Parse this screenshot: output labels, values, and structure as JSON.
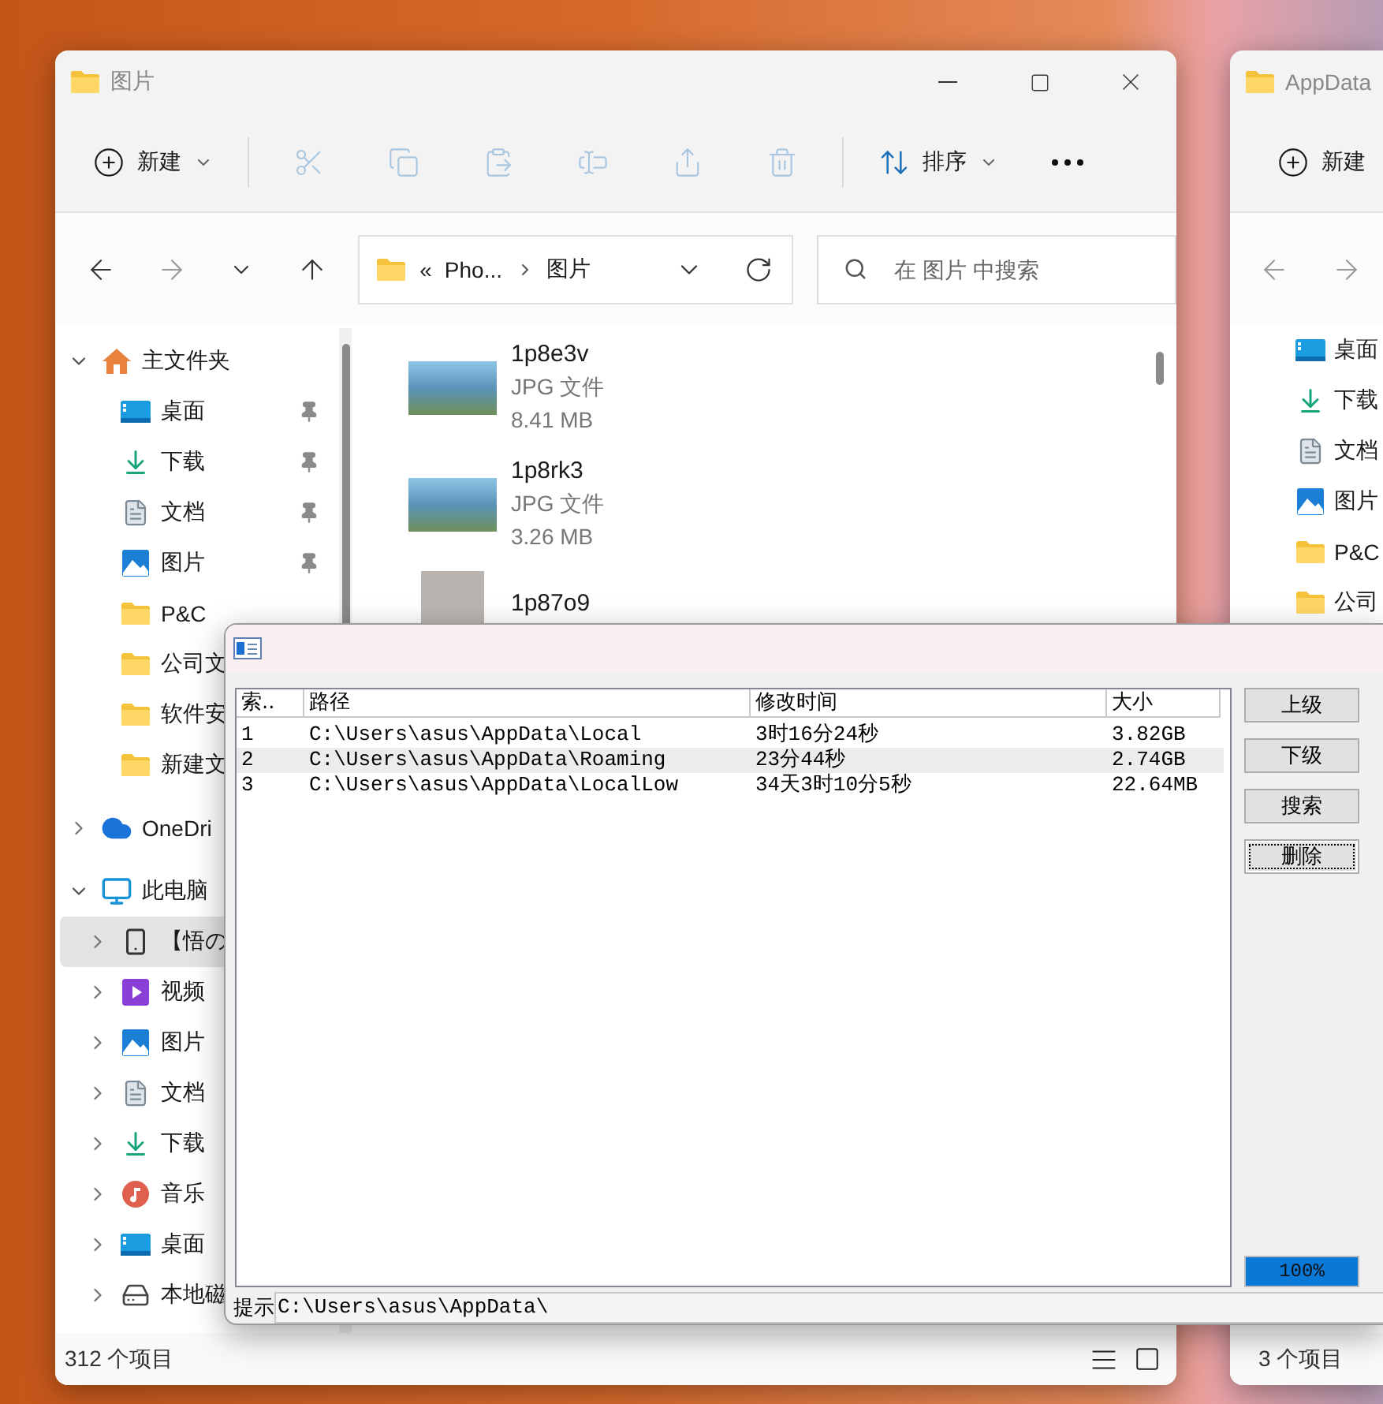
{
  "explorer": {
    "title": "图片",
    "toolbar": {
      "new_label": "新建",
      "actions_disabled": true,
      "sort_label": "排序"
    },
    "address": {
      "overflow": "«",
      "crumbs": [
        "Pho...",
        "图片"
      ]
    },
    "search": {
      "placeholder": "在 图片 中搜索"
    },
    "sidebar": [
      {
        "label": "主文件夹",
        "kind": "home",
        "expanded": true,
        "selected": false,
        "children": [
          {
            "label": "桌面",
            "kind": "desktop",
            "pinned": true,
            "selected": false
          },
          {
            "label": "下载",
            "kind": "download",
            "pinned": true,
            "selected": false
          },
          {
            "label": "文档",
            "kind": "document",
            "pinned": true,
            "selected": false
          },
          {
            "label": "图片",
            "kind": "pictures",
            "pinned": true,
            "selected": false
          },
          {
            "label": "P&C",
            "kind": "folder",
            "pinned": false,
            "selected": false
          },
          {
            "label": "公司文",
            "kind": "folder",
            "pinned": false,
            "selected": false
          },
          {
            "label": "软件安",
            "kind": "folder",
            "pinned": false,
            "selected": false
          },
          {
            "label": "新建文",
            "kind": "folder",
            "pinned": false,
            "selected": false
          }
        ]
      },
      {
        "label": "OneDri",
        "kind": "cloud",
        "expanded": false,
        "selected": false
      },
      {
        "label": "此电脑",
        "kind": "pc",
        "expanded": true,
        "selected": false,
        "children": [
          {
            "label": "【悟の",
            "kind": "phone",
            "expanded": false,
            "selected": true
          },
          {
            "label": "视频",
            "kind": "video",
            "expanded": false,
            "selected": false
          },
          {
            "label": "图片",
            "kind": "pictures",
            "expanded": false,
            "selected": false
          },
          {
            "label": "文档",
            "kind": "document",
            "expanded": false,
            "selected": false
          },
          {
            "label": "下载",
            "kind": "download",
            "expanded": false,
            "selected": false
          },
          {
            "label": "音乐",
            "kind": "music",
            "expanded": false,
            "selected": false
          },
          {
            "label": "桌面",
            "kind": "desktop",
            "expanded": false,
            "selected": false
          },
          {
            "label": "本地磁",
            "kind": "drive",
            "expanded": false,
            "selected": false
          }
        ]
      }
    ],
    "files": [
      {
        "name": "1p8e3v",
        "type": "JPG 文件",
        "size": "8.41 MB",
        "kind": "landscape"
      },
      {
        "name": "1p8rk3",
        "type": "JPG 文件",
        "size": "3.26 MB",
        "kind": "landscape"
      },
      {
        "name": "1p87o9",
        "kind": "portrait"
      }
    ],
    "status": "312 个项目"
  },
  "appdata_window": {
    "title": "AppData",
    "new_label": "新建",
    "sidebar": [
      {
        "label": "桌面",
        "kind": "desktop"
      },
      {
        "label": "下载",
        "kind": "download"
      },
      {
        "label": "文档",
        "kind": "document"
      },
      {
        "label": "图片",
        "kind": "pictures"
      },
      {
        "label": "P&C",
        "kind": "folder"
      },
      {
        "label": "公司",
        "kind": "folder"
      }
    ],
    "status": "3 个项目"
  },
  "dialog": {
    "columns": [
      "索..",
      "路径",
      "修改时间",
      "大小"
    ],
    "rows": [
      {
        "cells": [
          "1",
          "C:\\Users\\asus\\AppData\\Local",
          "3时16分24秒",
          "3.82GB"
        ],
        "selected": false
      },
      {
        "cells": [
          "2",
          "C:\\Users\\asus\\AppData\\Roaming",
          "23分44秒",
          "2.74GB"
        ],
        "selected": true
      },
      {
        "cells": [
          "3",
          "C:\\Users\\asus\\AppData\\LocalLow",
          "34天3时10分5秒",
          "22.64MB"
        ],
        "selected": false
      }
    ],
    "buttons": [
      {
        "label": "上级",
        "focused": false
      },
      {
        "label": "下级",
        "focused": false
      },
      {
        "label": "搜索",
        "focused": false
      },
      {
        "label": "删除",
        "focused": true
      }
    ],
    "progress": {
      "level": 1,
      "reading": "100%"
    },
    "hint_label": "提示",
    "path_value": "C:\\Users\\asus\\AppData\\"
  }
}
